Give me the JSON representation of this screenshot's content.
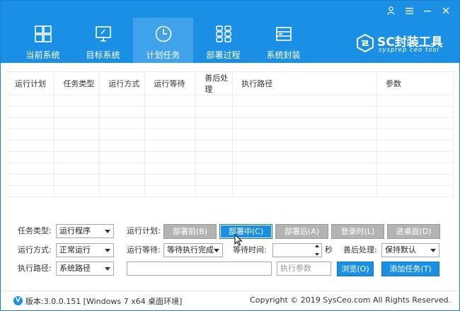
{
  "window_controls": [
    "A",
    "≡",
    "−",
    "×"
  ],
  "nav": {
    "tabs": [
      {
        "label": "当前系统",
        "icon": "windows-icon",
        "active": false
      },
      {
        "label": "目标系统",
        "icon": "monitor-icon",
        "active": false
      },
      {
        "label": "计划任务",
        "icon": "clock-icon",
        "active": true
      },
      {
        "label": "部署过程",
        "icon": "grid-icon",
        "active": false
      },
      {
        "label": "系统封装",
        "icon": "drive-icon",
        "active": false
      }
    ]
  },
  "logo": {
    "brand": "SC封装工具",
    "slogan": "sysprep ceo tool"
  },
  "table": {
    "headers": [
      "运行计划",
      "任务类型",
      "运行方式",
      "运行等待",
      "善后处理",
      "执行路径",
      "参数"
    ],
    "rows": []
  },
  "form": {
    "task_type_label": "任务类型:",
    "task_type_value": "运行程序",
    "run_plan_label": "运行计划:",
    "plan_buttons": [
      {
        "label": "部署前(B)",
        "selected": false
      },
      {
        "label": "部署中(C)",
        "selected": true
      },
      {
        "label": "部署后(A)",
        "selected": false
      },
      {
        "label": "登录时(L)",
        "selected": false
      },
      {
        "label": "进桌面(D)",
        "selected": false
      }
    ],
    "run_mode_label": "运行方式:",
    "run_mode_value": "正常运行",
    "run_wait_label": "运行等待:",
    "run_wait_value": "等待执行完成",
    "wait_time_label": "等待时间:",
    "wait_time_value": "",
    "seconds_label": "秒",
    "after_label": "善后处理:",
    "after_value": "保持默认",
    "exec_path_label": "执行路径:",
    "exec_path_value": "系统路径",
    "path_input_value": "",
    "param_placeholder": "执行参数",
    "browse_label": "浏览(O)",
    "add_task_label": "添加任务(T)"
  },
  "status": {
    "version": "版本:3.0.0.151 [Windows 7 x64 桌面环境]",
    "copyright": "Copyright © 2019 SysCeo.com All Rights Reserved."
  },
  "colors": {
    "accent": "#1a8fe3",
    "active_tab": "#3fa2ea",
    "gray_button": "#b3b3b3"
  }
}
